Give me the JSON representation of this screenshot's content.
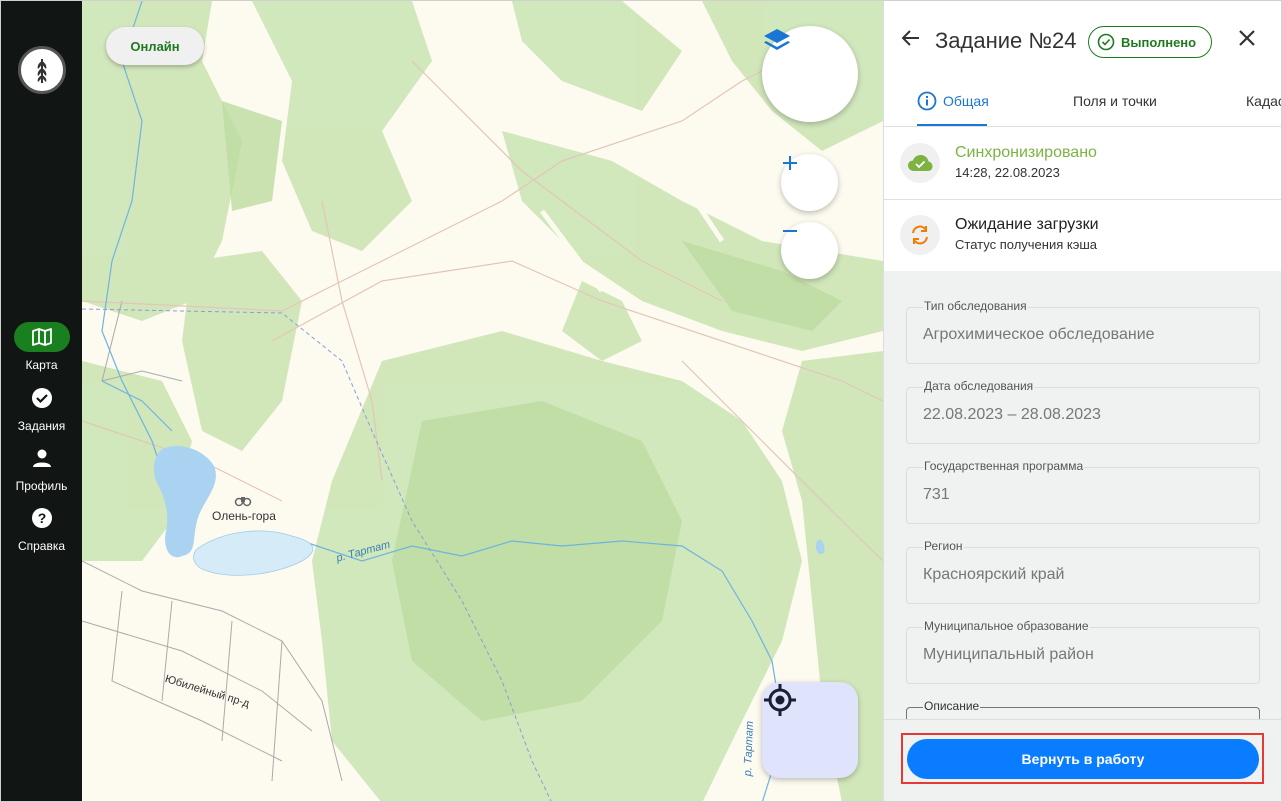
{
  "sidebar": {
    "items": [
      {
        "label": "Карта",
        "icon": "map-icon",
        "active": true
      },
      {
        "label": "Задания",
        "icon": "check-circle-icon",
        "active": false
      },
      {
        "label": "Профиль",
        "icon": "person-icon",
        "active": false
      },
      {
        "label": "Справка",
        "icon": "help-icon",
        "active": false
      }
    ]
  },
  "map": {
    "online_label": "Онлайн",
    "place_label": "Олень-гора",
    "river_label_1": "р. Тартат",
    "river_label_2": "р. Тартат",
    "street_label": "Юбилейный пр-д"
  },
  "panel": {
    "title": "Задание №24",
    "status": "Выполнено",
    "tabs": [
      {
        "label": "Общая",
        "active": true
      },
      {
        "label": "Поля и точки",
        "active": false
      },
      {
        "label": "Кадастр",
        "active": false
      }
    ],
    "sync": {
      "title": "Синхронизировано",
      "subtitle": "14:28, 22.08.2023"
    },
    "cache": {
      "title": "Ожидание загрузки",
      "subtitle": "Статус получения кэша"
    },
    "fields": [
      {
        "label": "Тип обследования",
        "value": "Агрохимическое обследование"
      },
      {
        "label": "Дата обследования",
        "value": "22.08.2023 – 28.08.2023"
      },
      {
        "label": "Государственная программа",
        "value": "731"
      },
      {
        "label": "Регион",
        "value": "Красноярский край"
      },
      {
        "label": "Муниципальное образование",
        "value": "Муниципальный район"
      },
      {
        "label": "Описание",
        "value": ""
      }
    ],
    "return_button": "Вернуть в работу"
  },
  "colors": {
    "accent": "#1976d2",
    "primary_button": "#0a7cff",
    "success": "#1f7a1f",
    "sync_green": "#7cb342",
    "sync_orange": "#f57c00",
    "highlight": "#e53935"
  }
}
